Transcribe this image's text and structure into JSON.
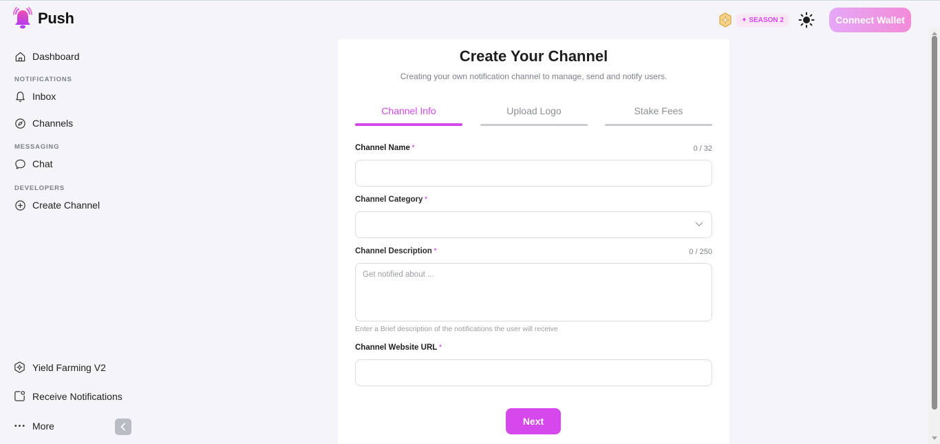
{
  "app": {
    "name": "Push"
  },
  "header": {
    "season_label": "✦ SEASON 2",
    "connect_wallet": "Connect Wallet"
  },
  "sidebar": {
    "dashboard": "Dashboard",
    "section_notifications": "NOTIFICATIONS",
    "inbox": "Inbox",
    "channels": "Channels",
    "section_messaging": "MESSAGING",
    "chat": "Chat",
    "section_developers": "DEVELOPERS",
    "create_channel": "Create Channel",
    "yield_farming": "Yield Farming V2",
    "receive_notifications": "Receive Notifications",
    "more": "More"
  },
  "form": {
    "title": "Create Your Channel",
    "subtitle": "Creating your own notification channel to manage, send and notify users.",
    "tabs": [
      "Channel Info",
      "Upload Logo",
      "Stake Fees"
    ],
    "active_tab": 0,
    "channel_name_label": "Channel Name",
    "channel_name_counter": "0 / 32",
    "channel_name_value": "",
    "channel_category_label": "Channel Category",
    "channel_category_value": "",
    "channel_description_label": "Channel Description",
    "channel_description_counter": "0 / 250",
    "channel_description_placeholder": "Get notified about ...",
    "channel_description_hint": "Enter a Brief description of the notifications the user will receive",
    "channel_website_label": "Channel Website URL",
    "channel_website_value": "",
    "required_mark": "*",
    "next_button": "Next"
  },
  "colors": {
    "accent": "#d548ec",
    "background": "#f4f4f9",
    "card": "#ffffff"
  }
}
